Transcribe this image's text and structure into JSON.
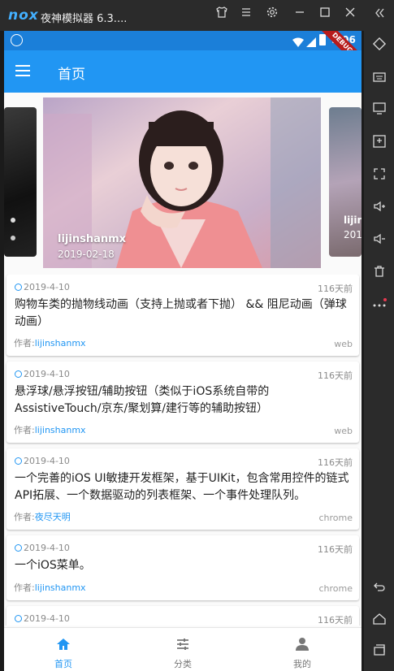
{
  "emulator": {
    "logo": "nox",
    "title": "夜神模拟器 6.3....",
    "controls": [
      "shirt-icon",
      "menu-icon",
      "gear-icon",
      "minimize-icon",
      "maximize-icon",
      "close-icon",
      "collapse-icon"
    ],
    "side_tools": [
      "diamond-icon",
      "keyboard-icon",
      "screen-icon",
      "apk-install-icon",
      "fullscreen-icon",
      "volume-up-icon",
      "volume-down-icon",
      "trash-icon",
      "more-icon",
      "back-icon",
      "home-icon",
      "recent-icon"
    ]
  },
  "status_bar": {
    "time": "9:06",
    "debug_banner": "DEBUG"
  },
  "app_bar": {
    "title": "首页"
  },
  "carousel": {
    "main": {
      "name": "lijinshanmx",
      "date": "2019-02-18"
    },
    "right_peek": {
      "name": "lijin",
      "date": "201"
    }
  },
  "posts": [
    {
      "date": "2019-4-10",
      "ago": "116天前",
      "title": "购物车类的抛物线动画（支持上抛或者下抛） && 阻尼动画（弹球动画）",
      "author_label": "作者:",
      "author": "lijinshanmx",
      "source": "web"
    },
    {
      "date": "2019-4-10",
      "ago": "116天前",
      "title": "悬浮球/悬浮按钮/辅助按钮（类似于iOS系统自带的AssistiveTouch/京东/聚划算/建行等的辅助按钮）",
      "author_label": "作者:",
      "author": "lijinshanmx",
      "source": "web"
    },
    {
      "date": "2019-4-10",
      "ago": "116天前",
      "title": "一个完善的iOS UI敏捷开发框架，基于UIKit，包含常用控件的链式API拓展、一个数据驱动的列表框架、一个事件处理队列。",
      "author_label": "作者:",
      "author": "夜尽天明",
      "source": "chrome"
    },
    {
      "date": "2019-4-10",
      "ago": "116天前",
      "title": "一个iOS菜单。",
      "author_label": "作者:",
      "author": "lijinshanmx",
      "source": "chrome"
    },
    {
      "date": "2019-4-10",
      "ago": "116天前"
    }
  ],
  "bottom_nav": [
    {
      "label": "首页",
      "icon": "home-icon",
      "active": true
    },
    {
      "label": "分类",
      "icon": "tune-icon",
      "active": false
    },
    {
      "label": "我的",
      "icon": "person-icon",
      "active": false
    }
  ],
  "colors": {
    "primary": "#2196f3",
    "status_bar": "#1b7fd9",
    "emulator_chrome": "#2b2b2b"
  }
}
